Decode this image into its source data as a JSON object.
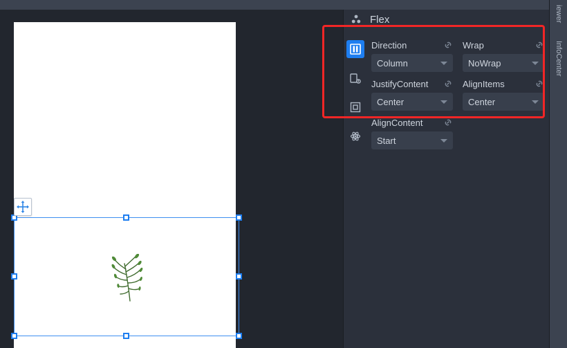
{
  "panel": {
    "title": "Flex",
    "rail": {
      "cluster": "cluster-icon",
      "items": [
        "layout-icon",
        "info-icon",
        "box-model-icon",
        "atom-icon"
      ]
    },
    "groups": [
      {
        "row": [
          {
            "label": "Direction",
            "value": "Column"
          },
          {
            "label": "Wrap",
            "value": "NoWrap"
          }
        ]
      },
      {
        "row": [
          {
            "label": "JustifyContent",
            "value": "Center"
          },
          {
            "label": "AlignItems",
            "value": "Center"
          }
        ]
      },
      {
        "row": [
          {
            "label": "AlignContent",
            "value": "Start"
          }
        ]
      }
    ]
  },
  "sideTabs": {
    "top": "iewer",
    "second": "InfoCenter"
  },
  "canvas": {
    "selectedElement": "image-placeholder"
  }
}
